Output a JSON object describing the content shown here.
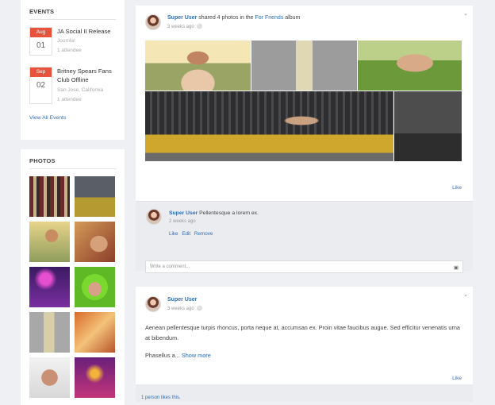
{
  "events": {
    "title": "EVENTS",
    "items": [
      {
        "month": "Aug",
        "day": "01",
        "title": "JA Social II Release",
        "location": "Joomla!",
        "attendees": "1 attendee"
      },
      {
        "month": "Sep",
        "day": "02",
        "title": "Britney Spears Fans Club Offline",
        "location": "San Jose, California",
        "attendees": "1 attendee"
      }
    ],
    "view_all": "View All Events"
  },
  "photos": {
    "title": "PHOTOS",
    "thumbs": [
      {
        "icon": "arcade-photo"
      },
      {
        "icon": "man-on-sofa-photo"
      },
      {
        "icon": "woman-sunglasses-photo"
      },
      {
        "icon": "woman-lying-photo"
      },
      {
        "icon": "concert-photo"
      },
      {
        "icon": "green-hair-woman-photo"
      },
      {
        "icon": "man-standing-photo"
      },
      {
        "icon": "party-drinks-photo"
      },
      {
        "icon": "woman-portrait-photo"
      },
      {
        "icon": "nightclub-photo"
      }
    ]
  },
  "post1": {
    "author": "Super User",
    "action": " shared 4 photos in the ",
    "album_name": "For Friends",
    "album_word": " album",
    "time": "3 weeks ago",
    "like": "Like",
    "comment": {
      "author": "Super User",
      "text": " Pellentesque a lorem ex.",
      "time": "2 weeks ago",
      "like": "Like",
      "edit": "Edit",
      "remove": "Remove"
    },
    "comment_placeholder": "Write a comment..."
  },
  "post2": {
    "author": "Super User",
    "time": "3 weeks ago",
    "body": "Aenean pellentesque turpis rhoncus, porta neque at, accumsan ex. Proin vitae faucibus augue. Sed efficitur venenatis urna at bibendum.",
    "body2": "Phasellus a...",
    "show_more": "Show more",
    "like": "Like",
    "likes_count": "1 person likes this."
  },
  "colors": {
    "accent": "#2e6db4",
    "event_red": "#e8533d"
  }
}
